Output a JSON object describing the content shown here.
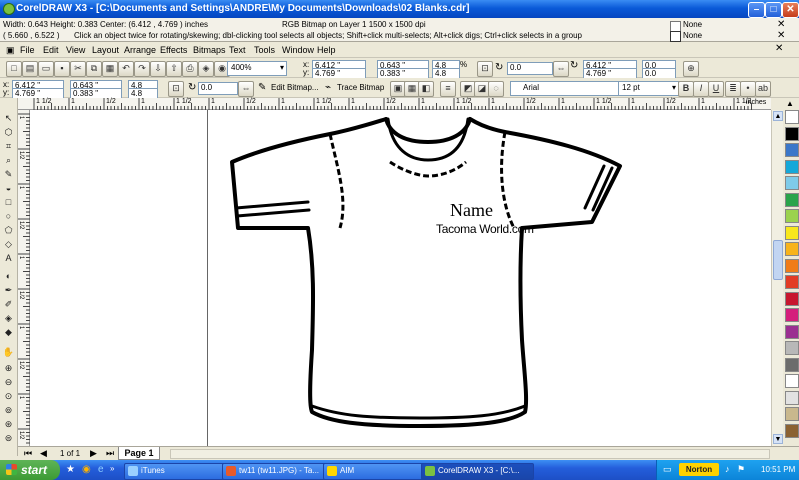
{
  "window": {
    "title": "CorelDRAW X3 - [C:\\Documents and Settings\\ANDRE\\My Documents\\Downloads\\02 Blanks.cdr]"
  },
  "status": {
    "dimensions": "Width: 0.643  Height: 0.383  Center: (6.412 , 4.769 )  inches",
    "object_info": "RGB Bitmap on Layer 1 1500 x 1500 dpi",
    "cursor_pos": "( 5.660 , 6.522 )",
    "hint": "Click an object twice for rotating/skewing; dbl-clicking tool selects all objects; Shift+click multi-selects; Alt+click digs; Ctrl+click selects in a group",
    "fill_label": "None",
    "outline_label": "None"
  },
  "menu": [
    "File",
    "Edit",
    "View",
    "Layout",
    "Arrange",
    "Effects",
    "Bitmaps",
    "Text",
    "Tools",
    "Window",
    "Help"
  ],
  "standard_toolbar": {
    "zoom": "400%",
    "x": "6.412 \"",
    "y": "4.769 \"",
    "w": "0.643 \"",
    "h": "0.383 \"",
    "scale_w": "4.8",
    "scale_h": "4.8",
    "pct": "%",
    "angle": "0.0",
    "x2": "6.412 \"",
    "y2": "4.769 \"",
    "angle2": "0.0",
    "angle3": "0.0"
  },
  "property_bar": {
    "x": "6.412 \"",
    "y": "4.769 \"",
    "w": "0.643 \"",
    "h": "0.383 \"",
    "scale_w": "4.8",
    "scale_h": "4.8",
    "angle": "0.0",
    "edit_bitmap": "Edit Bitmap...",
    "trace_bitmap": "Trace Bitmap",
    "font": "Arial",
    "font_size": "12 pt"
  },
  "ruler": {
    "units": "inches",
    "labels": [
      "1 1/2",
      "1",
      "1/2",
      "1",
      "1 1/2",
      "1",
      "1/2",
      "1",
      "1 1/2",
      "1",
      "1/2",
      "1",
      "1 1/2",
      "1",
      "1/2",
      "1",
      "1 1/2",
      "1",
      "1/2",
      "1",
      "1 1/2"
    ]
  },
  "vruler_labels": [
    "1",
    "1/2",
    "1",
    "1/2",
    "1",
    "1/2",
    "1",
    "1/2",
    "1",
    "1/2"
  ],
  "artwork": {
    "name_text": "Name",
    "site_text": "Tacoma World.com"
  },
  "page_nav": {
    "counter": "1 of 1",
    "tab": "Page 1"
  },
  "taskbar": {
    "start": "start",
    "tasks": [
      "iTunes",
      "tw11 (tw11.JPG) - Ta...",
      "AIM",
      "CorelDRAW X3 - [C:\\..."
    ],
    "norton": "Norton",
    "clock": "10:51 PM"
  },
  "palette_colors": [
    "#ffffff",
    "#000000",
    "#3b77c9",
    "#15a8d9",
    "#7fcbe9",
    "#2aa44b",
    "#9bd24e",
    "#f8e71c",
    "#f7b31b",
    "#f07c18",
    "#e23b25",
    "#c7172f",
    "#d51e7c",
    "#9b2f91",
    "#b8b8b8",
    "#6c6c6c",
    "#ffffff",
    "#e2e2e2",
    "#c9b88d",
    "#8b6232"
  ]
}
